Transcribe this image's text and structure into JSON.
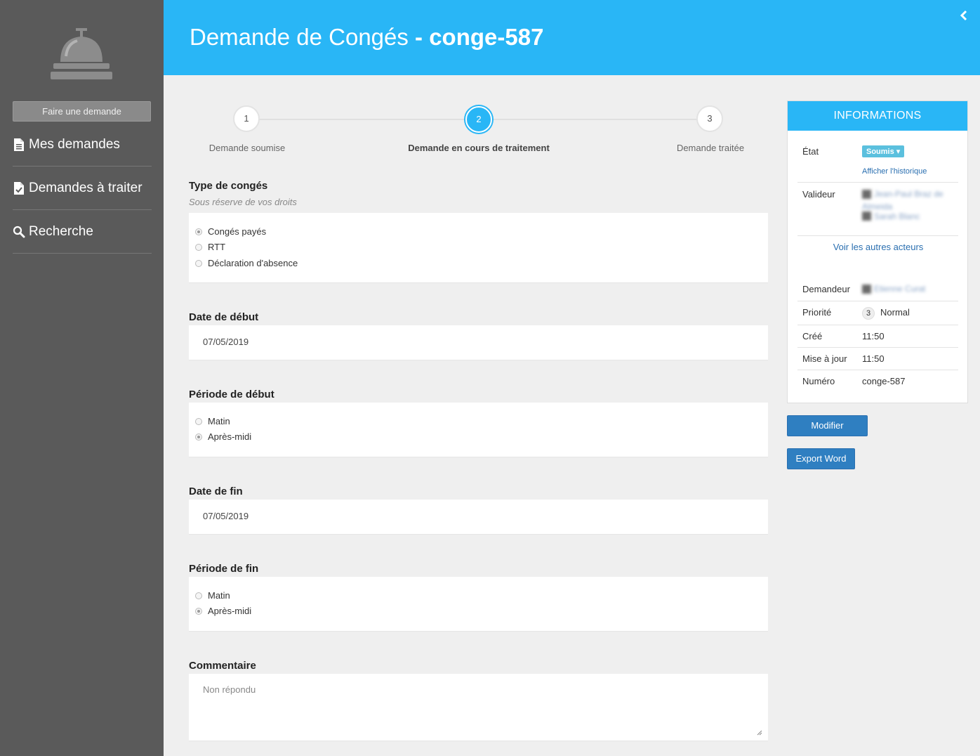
{
  "sidebar": {
    "new_request": "Faire une demande",
    "items": [
      {
        "label": "Mes demandes",
        "icon": "document-icon"
      },
      {
        "label": "Demandes à traiter",
        "icon": "document-check-icon"
      },
      {
        "label": "Recherche",
        "icon": "search-icon"
      }
    ]
  },
  "header": {
    "title": "Demande de Congés",
    "separator": " - ",
    "number": "conge-587"
  },
  "stepper": {
    "steps": [
      {
        "num": "1",
        "label": "Demande soumise"
      },
      {
        "num": "2",
        "label": "Demande en cours de traitement"
      },
      {
        "num": "3",
        "label": "Demande traitée"
      }
    ],
    "active_step": 2
  },
  "form": {
    "type": {
      "label": "Type de congés",
      "sub": "Sous réserve de vos droits",
      "options": [
        "Congés payés",
        "RTT",
        "Déclaration d'absence"
      ],
      "selected": 0
    },
    "start_date": {
      "label": "Date de début",
      "value": "07/05/2019"
    },
    "start_period": {
      "label": "Période de début",
      "options": [
        "Matin",
        "Après-midi"
      ],
      "selected": 1
    },
    "end_date": {
      "label": "Date de fin",
      "value": "07/05/2019"
    },
    "end_period": {
      "label": "Période de fin",
      "options": [
        "Matin",
        "Après-midi"
      ],
      "selected": 1
    },
    "comment": {
      "label": "Commentaire",
      "placeholder": "Non répondu"
    }
  },
  "info": {
    "title": "INFORMATIONS",
    "etat_label": "État",
    "etat_value": "Soumis ▾",
    "history_link": "Afficher l'historique",
    "validator_label": "Valideur",
    "validators": [
      "Jean-Paul Braz de",
      "Almeida",
      "Sarah Blanc"
    ],
    "other_actors": "Voir les autres acteurs",
    "requester_label": "Demandeur",
    "requester": "Etienne Curat",
    "priority_label": "Priorité",
    "priority_num": "3",
    "priority_value": "Normal",
    "created_label": "Créé",
    "created_value": "11:50",
    "updated_label": "Mise à jour",
    "updated_value": "11:50",
    "number_label": "Numéro",
    "number_value": "conge-587"
  },
  "actions": {
    "modify": "Modifier",
    "export": "Export Word"
  },
  "colors": {
    "accent": "#29b6f6",
    "sidebar": "#5a5a5a",
    "button": "#2f7fc1"
  }
}
